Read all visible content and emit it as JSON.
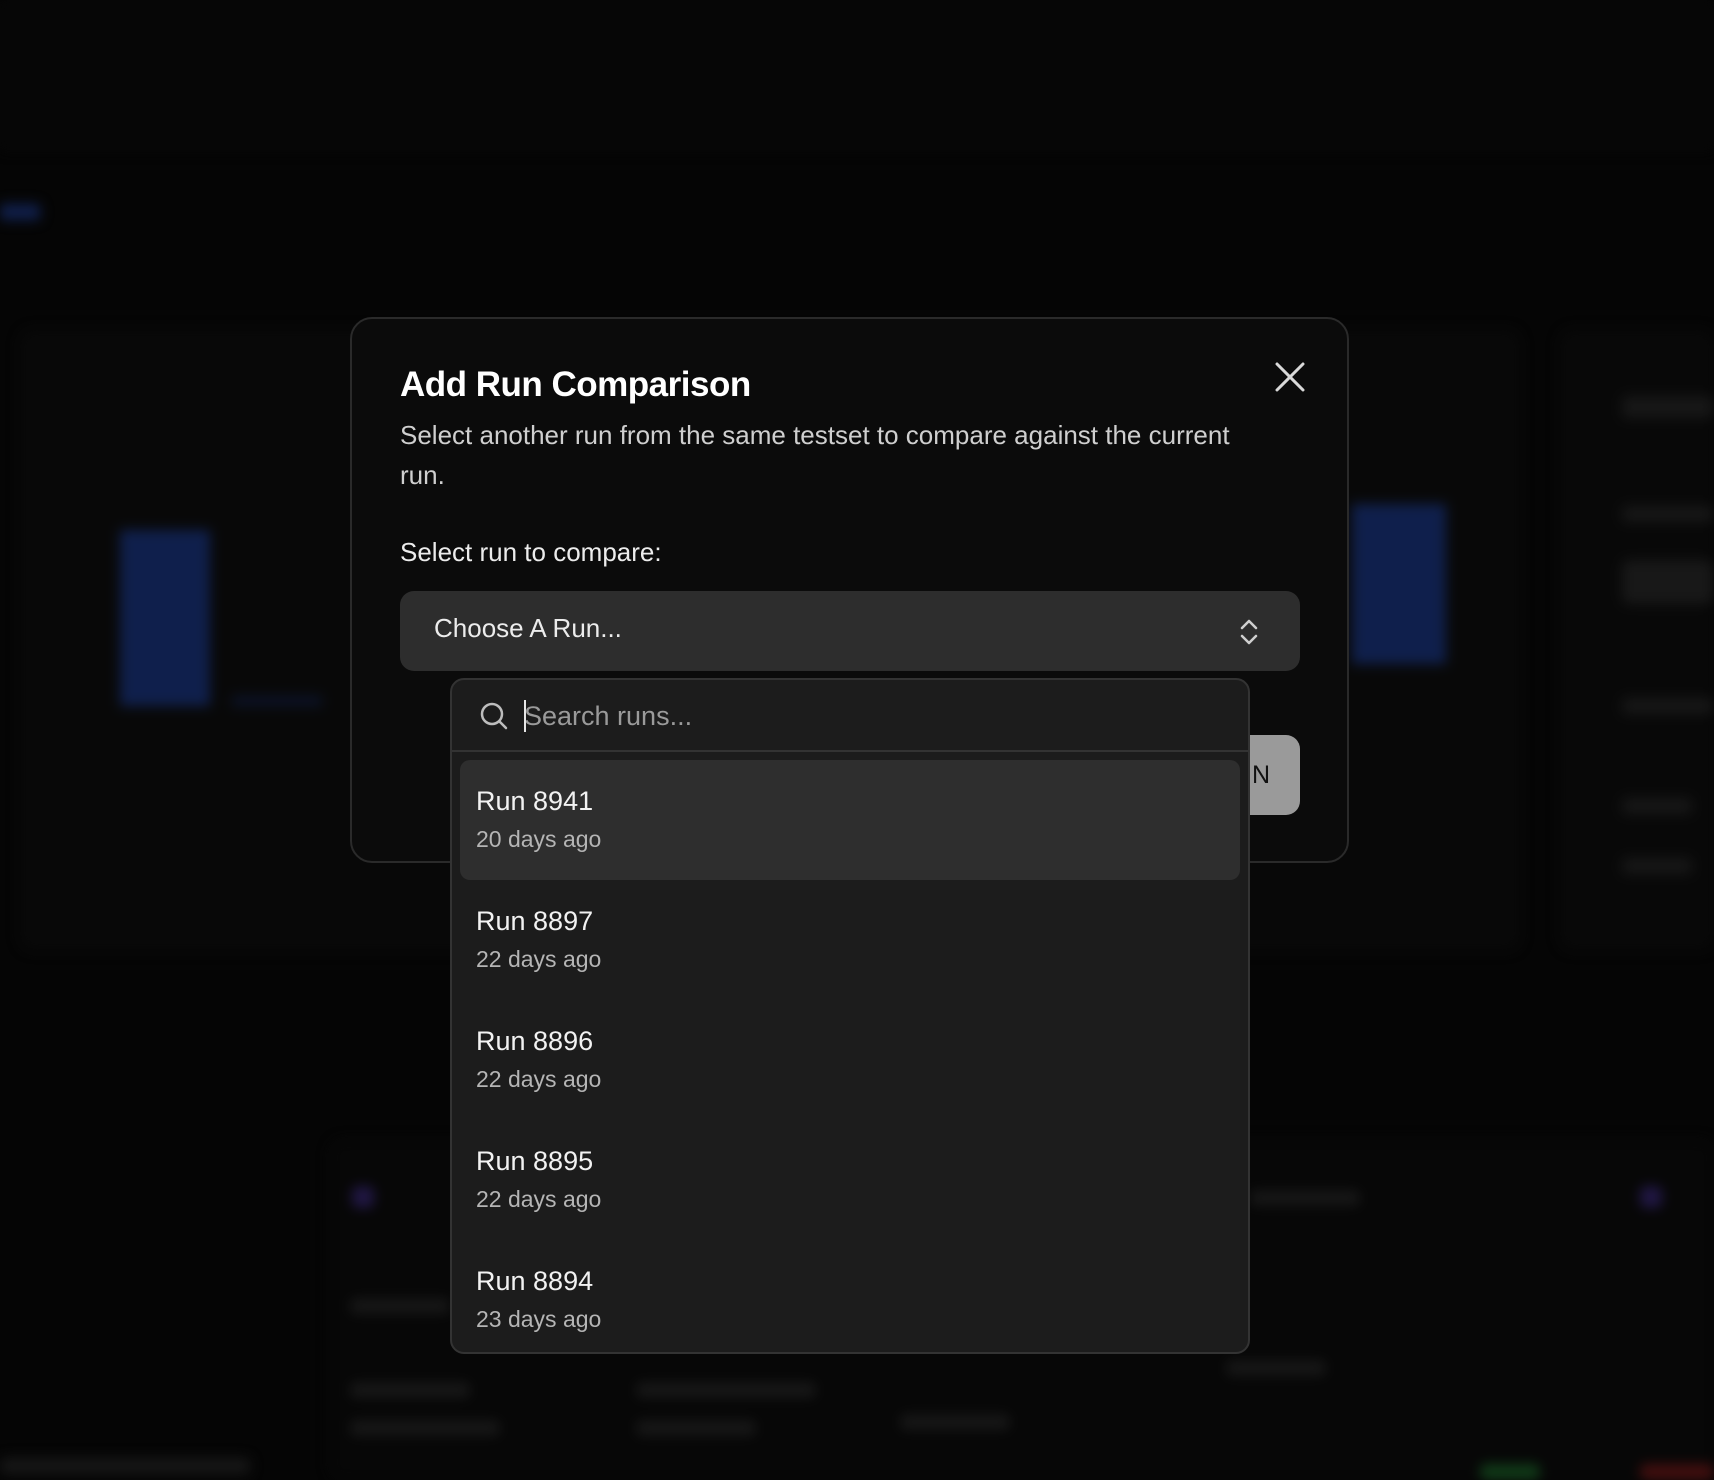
{
  "dialog": {
    "title": "Add Run Comparison",
    "description": "Select another run from the same testset to compare against the current run.",
    "select_label": "Select run to compare:",
    "select_placeholder": "Choose A Run...",
    "confirm_button_partial": "N",
    "close_icon": "close-icon",
    "chevron_icon": "chevron-up-down-icon"
  },
  "dropdown": {
    "search_placeholder": "Search runs...",
    "search_icon": "search-icon",
    "runs": [
      {
        "name": "Run 8941",
        "time": "20 days ago",
        "highlighted": true
      },
      {
        "name": "Run 8897",
        "time": "22 days ago",
        "highlighted": false
      },
      {
        "name": "Run 8896",
        "time": "22 days ago",
        "highlighted": false
      },
      {
        "name": "Run 8895",
        "time": "22 days ago",
        "highlighted": false
      },
      {
        "name": "Run 8894",
        "time": "23 days ago",
        "highlighted": false
      }
    ]
  },
  "colors": {
    "background": "#0a0a0a",
    "dialog_bg": "#0b0b0b",
    "select_bg": "#2d2d2d",
    "dropdown_bg": "#1c1c1c",
    "highlight_bg": "#2e2e2e",
    "chart_bar": "#1d3a8a"
  }
}
